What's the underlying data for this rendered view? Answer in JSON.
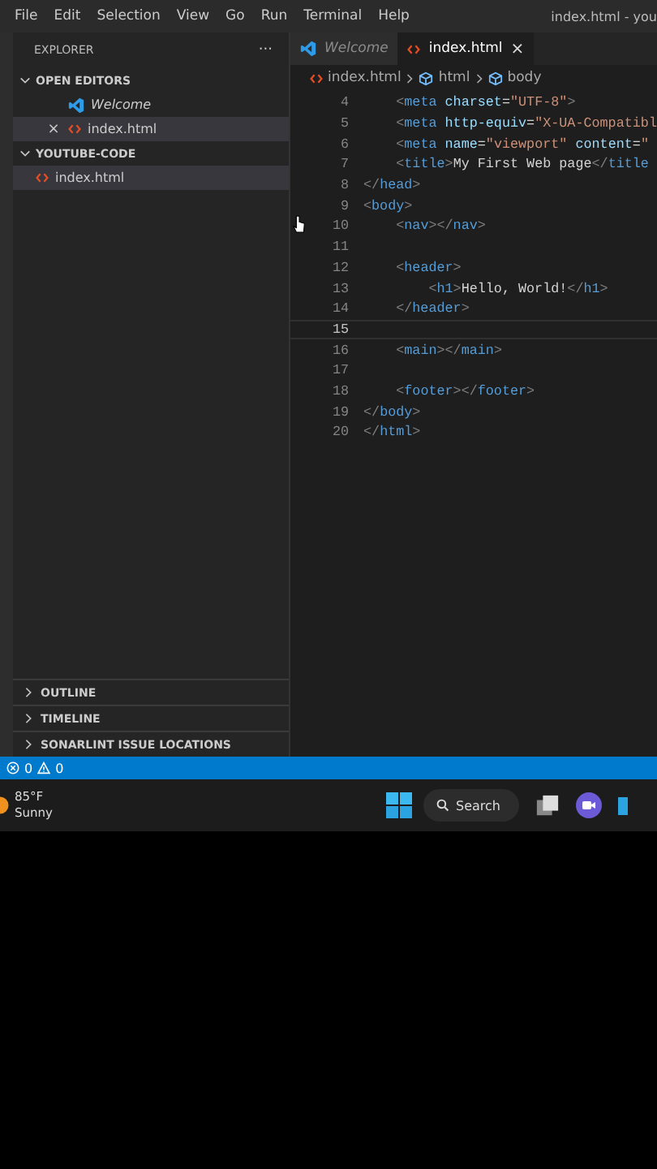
{
  "menu": [
    "File",
    "Edit",
    "Selection",
    "View",
    "Go",
    "Run",
    "Terminal",
    "Help"
  ],
  "window": {
    "title": "index.html - you"
  },
  "sidebar": {
    "title": "EXPLORER",
    "more": "···",
    "sections": [
      {
        "label": "OPEN EDITORS",
        "expanded": true,
        "items": [
          {
            "label": "Welcome",
            "kind": "vscode",
            "preview": true,
            "selected": false
          },
          {
            "label": "index.html",
            "kind": "html",
            "preview": false,
            "selected": true,
            "close": "×"
          }
        ]
      },
      {
        "label": "YOUTUBE-CODE",
        "expanded": true,
        "items": [
          {
            "label": "index.html",
            "kind": "html",
            "preview": false,
            "selected": true
          }
        ]
      }
    ],
    "panels": [
      {
        "label": "OUTLINE",
        "expanded": false
      },
      {
        "label": "TIMELINE",
        "expanded": false
      },
      {
        "label": "SONARLINT ISSUE LOCATIONS",
        "expanded": false
      }
    ]
  },
  "tabs": [
    {
      "label": "Welcome",
      "kind": "vscode",
      "preview": true,
      "selected": false
    },
    {
      "label": "index.html",
      "kind": "html",
      "preview": false,
      "selected": true,
      "close": "×"
    }
  ],
  "breadcrumb": [
    {
      "label": "index.html",
      "kind": "html"
    },
    {
      "label": "html",
      "kind": "cube"
    },
    {
      "label": "body",
      "kind": "cube"
    }
  ],
  "code": [
    {
      "number": "4",
      "current": false,
      "tokens": [
        {
          "kind": "punct",
          "text": "    <"
        },
        {
          "kind": "tag",
          "text": "meta"
        },
        {
          "kind": "attr",
          "text": " charset"
        },
        {
          "kind": "text",
          "text": "="
        },
        {
          "kind": "string",
          "text": "\"UTF-8\""
        },
        {
          "kind": "punct",
          "text": ">"
        }
      ]
    },
    {
      "number": "5",
      "current": false,
      "tokens": [
        {
          "kind": "punct",
          "text": "    <"
        },
        {
          "kind": "tag",
          "text": "meta"
        },
        {
          "kind": "attr",
          "text": " http-equiv"
        },
        {
          "kind": "text",
          "text": "="
        },
        {
          "kind": "string",
          "text": "\"X-UA-Compatibl"
        }
      ]
    },
    {
      "number": "6",
      "current": false,
      "tokens": [
        {
          "kind": "punct",
          "text": "    <"
        },
        {
          "kind": "tag",
          "text": "meta"
        },
        {
          "kind": "attr",
          "text": " name"
        },
        {
          "kind": "text",
          "text": "="
        },
        {
          "kind": "string",
          "text": "\"viewport\""
        },
        {
          "kind": "attr",
          "text": " content"
        },
        {
          "kind": "text",
          "text": "="
        },
        {
          "kind": "string",
          "text": "\""
        }
      ]
    },
    {
      "number": "7",
      "current": false,
      "tokens": [
        {
          "kind": "punct",
          "text": "    <"
        },
        {
          "kind": "tag",
          "text": "title"
        },
        {
          "kind": "punct",
          "text": ">"
        },
        {
          "kind": "text",
          "text": "My First Web page"
        },
        {
          "kind": "punct",
          "text": "</"
        },
        {
          "kind": "tag",
          "text": "title"
        }
      ]
    },
    {
      "number": "8",
      "current": false,
      "tokens": [
        {
          "kind": "punct",
          "text": "</"
        },
        {
          "kind": "tag",
          "text": "head"
        },
        {
          "kind": "punct",
          "text": ">"
        }
      ]
    },
    {
      "number": "9",
      "current": false,
      "tokens": [
        {
          "kind": "punct",
          "text": "<"
        },
        {
          "kind": "tag",
          "text": "body"
        },
        {
          "kind": "punct",
          "text": ">"
        }
      ]
    },
    {
      "number": "10",
      "current": false,
      "tokens": [
        {
          "kind": "punct",
          "text": "    <"
        },
        {
          "kind": "tag",
          "text": "nav"
        },
        {
          "kind": "punct",
          "text": "></"
        },
        {
          "kind": "tag",
          "text": "nav"
        },
        {
          "kind": "punct",
          "text": ">"
        }
      ]
    },
    {
      "number": "11",
      "current": false
    },
    {
      "number": "12",
      "current": false,
      "tokens": [
        {
          "kind": "punct",
          "text": "    <"
        },
        {
          "kind": "tag",
          "text": "header"
        },
        {
          "kind": "punct",
          "text": ">"
        }
      ]
    },
    {
      "number": "13",
      "current": false,
      "tokens": [
        {
          "kind": "punct",
          "text": "        <"
        },
        {
          "kind": "tag",
          "text": "h1"
        },
        {
          "kind": "punct",
          "text": ">"
        },
        {
          "kind": "text",
          "text": "Hello, World!"
        },
        {
          "kind": "punct",
          "text": "</"
        },
        {
          "kind": "tag",
          "text": "h1"
        },
        {
          "kind": "punct",
          "text": ">"
        }
      ]
    },
    {
      "number": "14",
      "current": false,
      "tokens": [
        {
          "kind": "punct",
          "text": "    </"
        },
        {
          "kind": "tag",
          "text": "header"
        },
        {
          "kind": "punct",
          "text": ">"
        }
      ]
    },
    {
      "number": "15",
      "current": true
    },
    {
      "number": "16",
      "current": false,
      "tokens": [
        {
          "kind": "punct",
          "text": "    <"
        },
        {
          "kind": "tag",
          "text": "main"
        },
        {
          "kind": "punct",
          "text": "></"
        },
        {
          "kind": "tag",
          "text": "main"
        },
        {
          "kind": "punct",
          "text": ">"
        }
      ]
    },
    {
      "number": "17",
      "current": false
    },
    {
      "number": "18",
      "current": false,
      "tokens": [
        {
          "kind": "punct",
          "text": "    <"
        },
        {
          "kind": "tag",
          "text": "footer"
        },
        {
          "kind": "punct",
          "text": "></"
        },
        {
          "kind": "tag",
          "text": "footer"
        },
        {
          "kind": "punct",
          "text": ">"
        }
      ]
    },
    {
      "number": "19",
      "current": false,
      "tokens": [
        {
          "kind": "punct",
          "text": "</"
        },
        {
          "kind": "tag",
          "text": "body"
        },
        {
          "kind": "punct",
          "text": ">"
        }
      ]
    },
    {
      "number": "20",
      "current": false,
      "tokens": [
        {
          "kind": "punct",
          "text": "</"
        },
        {
          "kind": "tag",
          "text": "html"
        },
        {
          "kind": "punct",
          "text": ">"
        }
      ]
    }
  ],
  "status_bar": {
    "errors": "0",
    "warnings": "0"
  },
  "taskbar": {
    "weather": {
      "temperature": "85°F",
      "condition": "Sunny"
    },
    "search": {
      "label": "Search"
    }
  }
}
